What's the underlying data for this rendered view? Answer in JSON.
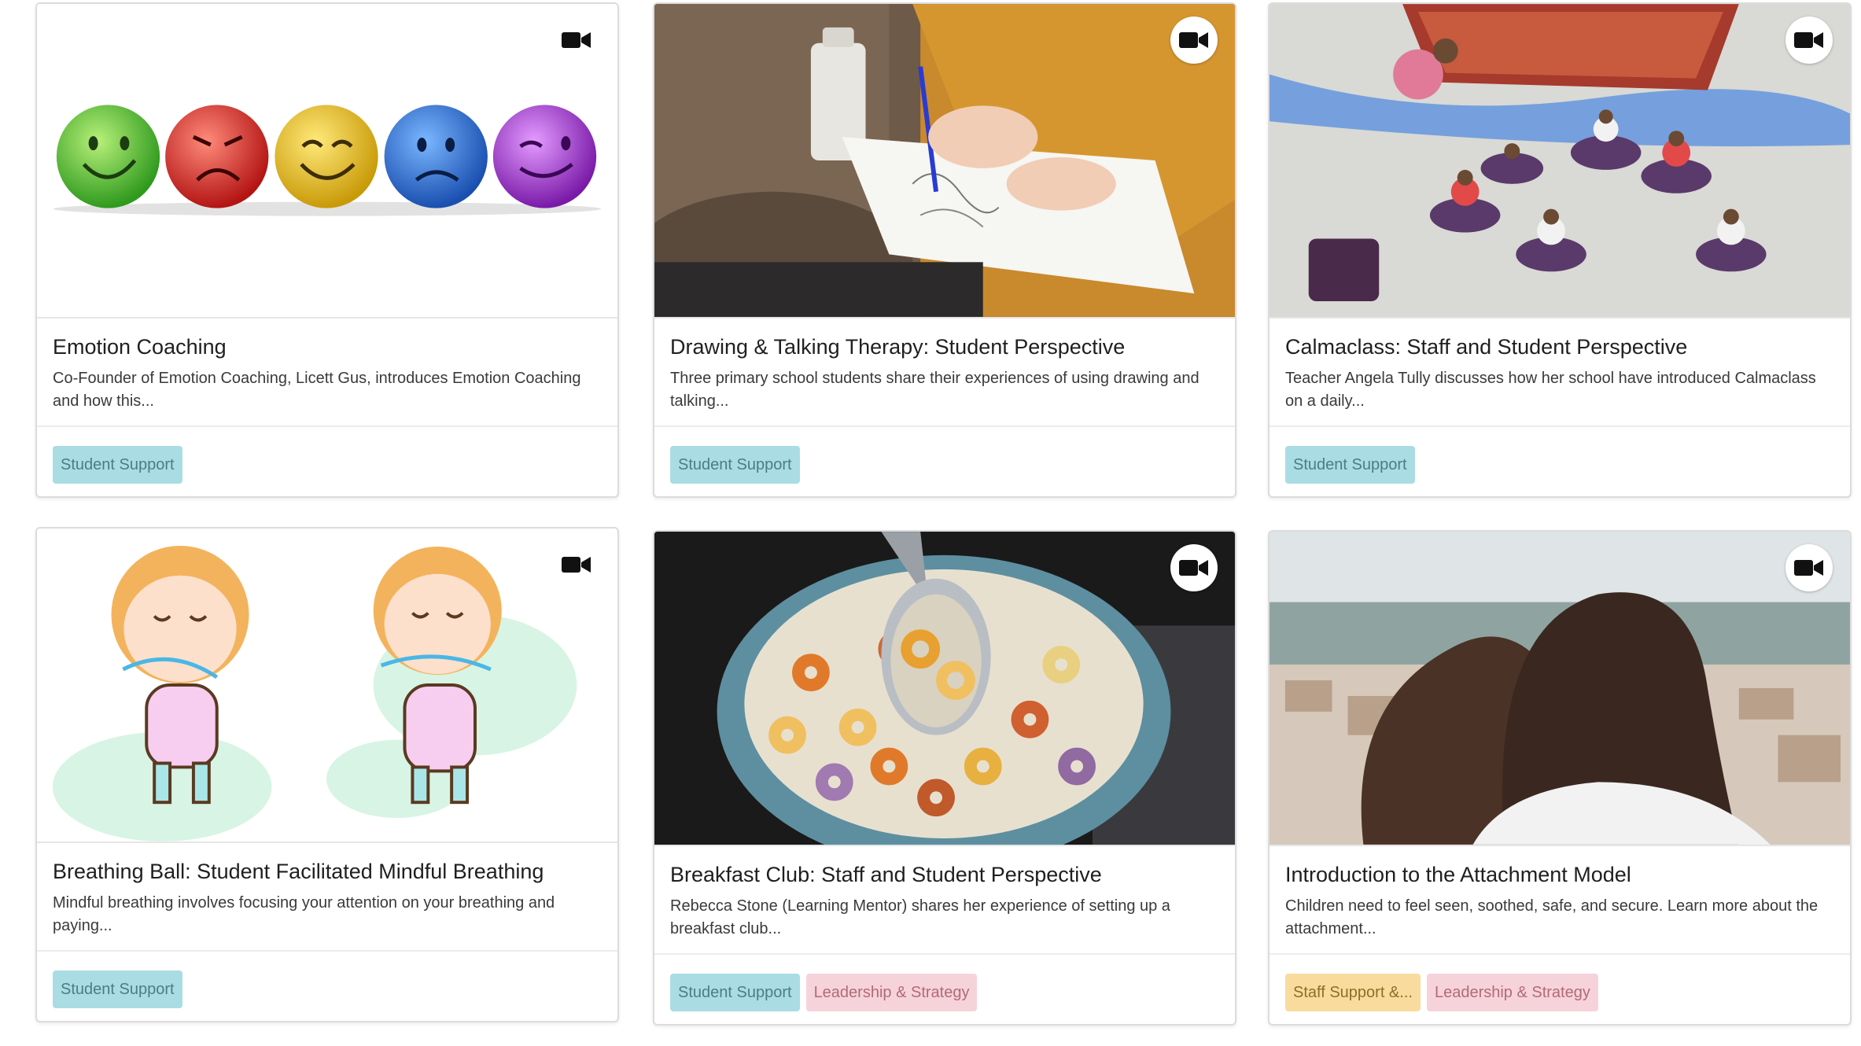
{
  "cards": [
    {
      "title": "Emotion Coaching",
      "description": "Co-Founder of Emotion Coaching, Licett Gus, introduces Emotion Coaching and how this...",
      "media_icon": "video-camera-icon",
      "tags": [
        "Student Support"
      ]
    },
    {
      "title": "Drawing & Talking Therapy: Student Perspective",
      "description": "Three primary school students share their experiences of using drawing and talking...",
      "media_icon": "video-camera-icon",
      "tags": [
        "Student Support"
      ]
    },
    {
      "title": "Calmaclass: Staff and Student Perspective",
      "description": "Teacher Angela Tully discusses how her school have introduced Calmaclass on a daily...",
      "media_icon": "video-camera-icon",
      "tags": [
        "Student Support"
      ]
    },
    {
      "title": "Breathing Ball: Student Facilitated Mindful Breathing",
      "description": "Mindful breathing involves focusing your attention on your breathing and paying...",
      "media_icon": "video-camera-icon",
      "tags": [
        "Student Support"
      ]
    },
    {
      "title": "Breakfast Club: Staff and Student Perspective",
      "description": "Rebecca Stone (Learning Mentor) shares her experience of setting up a breakfast club...",
      "media_icon": "video-camera-icon",
      "tags": [
        "Student Support",
        "Leadership & Strategy"
      ]
    },
    {
      "title": "Introduction to the Attachment Model",
      "description": "Children need to feel seen, soothed, safe, and secure. Learn more about the attachment...",
      "media_icon": "video-camera-icon",
      "tags": [
        "Staff Support &...",
        "Leadership & Strategy"
      ]
    }
  ],
  "colors": {
    "tag_student_support": "#a9dde3",
    "tag_leadership_strategy": "#f6d3da",
    "tag_staff_support": "#f9dc9d"
  }
}
